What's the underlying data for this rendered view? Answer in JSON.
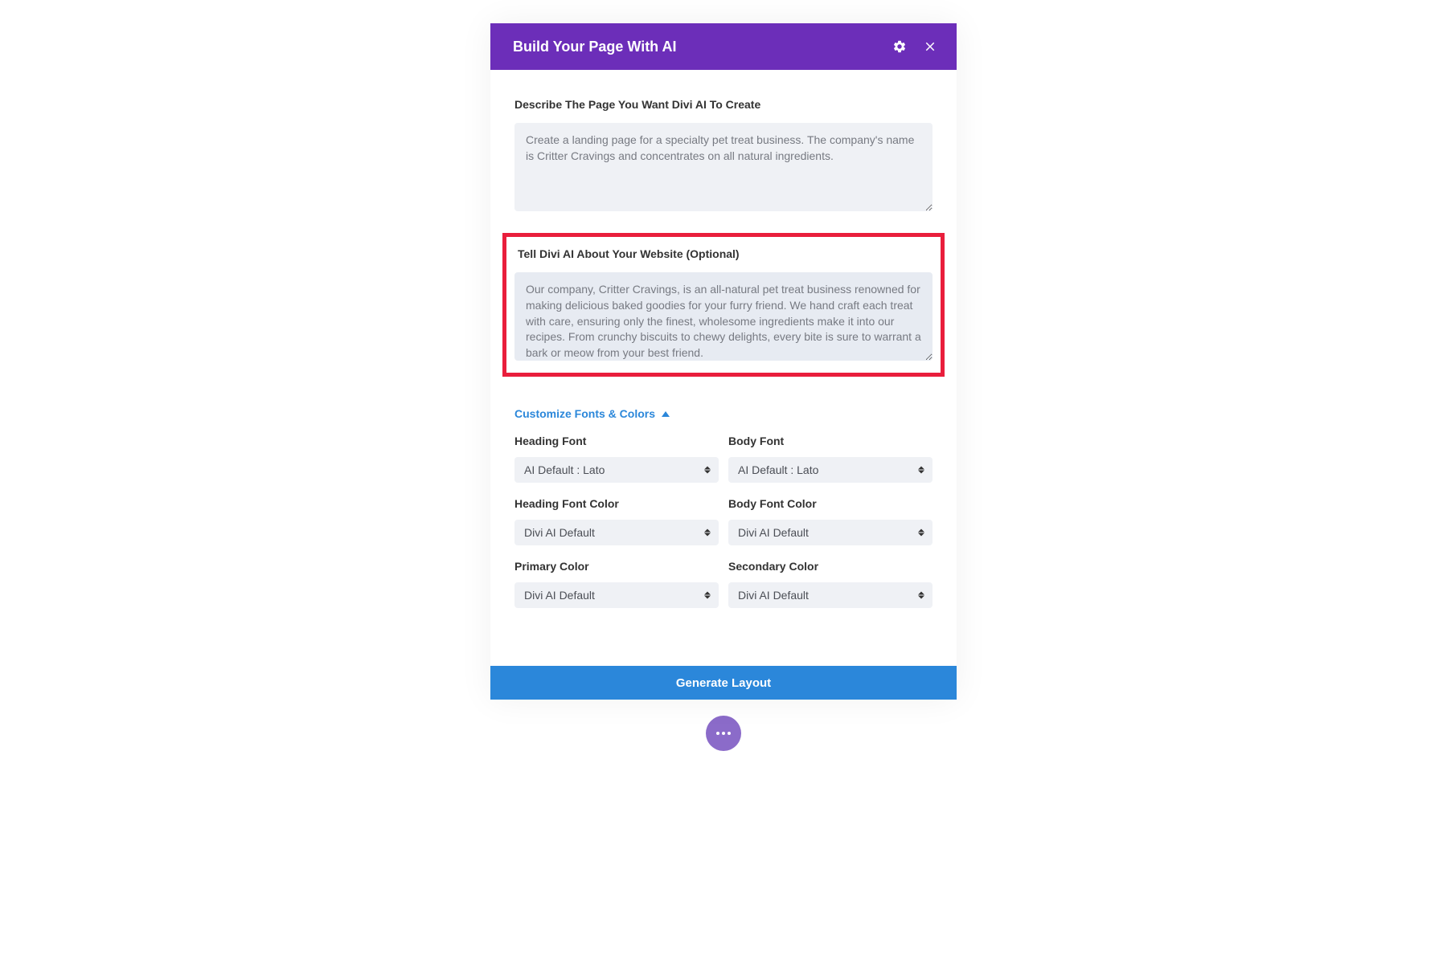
{
  "header": {
    "title": "Build Your Page With AI"
  },
  "describe": {
    "label": "Describe The Page You Want Divi AI To Create",
    "value": "Create a landing page for a specialty pet treat business. The company's name is Critter Cravings and concentrates on all natural ingredients."
  },
  "about": {
    "label": "Tell Divi AI About Your Website (Optional)",
    "value": "Our company, Critter Cravings, is an all-natural pet treat business renowned for making delicious baked goodies for your furry friend. We hand craft each treat with care, ensuring only the finest, wholesome ingredients make it into our recipes. From crunchy biscuits to chewy delights, every bite is sure to warrant a bark or meow from your best friend."
  },
  "customize": {
    "toggle_label": "Customize Fonts & Colors",
    "heading_font": {
      "label": "Heading Font",
      "value": "AI Default : Lato"
    },
    "body_font": {
      "label": "Body Font",
      "value": "AI Default : Lato"
    },
    "heading_font_color": {
      "label": "Heading Font Color",
      "value": "Divi AI Default"
    },
    "body_font_color": {
      "label": "Body Font Color",
      "value": "Divi AI Default"
    },
    "primary_color": {
      "label": "Primary Color",
      "value": "Divi AI Default"
    },
    "secondary_color": {
      "label": "Secondary Color",
      "value": "Divi AI Default"
    }
  },
  "footer": {
    "generate_label": "Generate Layout"
  }
}
